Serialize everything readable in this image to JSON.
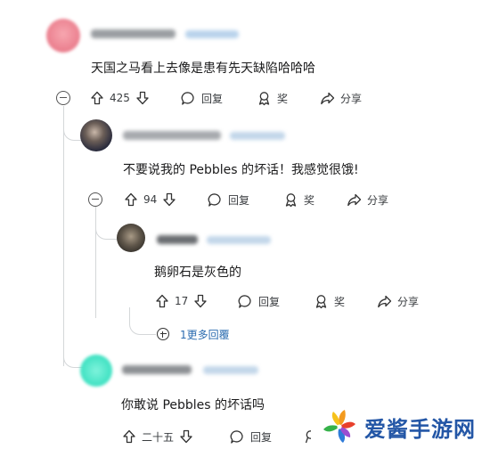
{
  "comments": [
    {
      "text": "天国之马看上去像是患有先天缺陷哈哈哈",
      "votes": "425",
      "reply_label": "回复",
      "award_label": "奖",
      "share_label": "分享"
    },
    {
      "text": "不要说我的 Pebbles 的坏话！我感觉很饿!",
      "votes": "94",
      "reply_label": "回复",
      "award_label": "奖",
      "share_label": "分享"
    },
    {
      "text": "鹅卵石是灰色的",
      "votes": "17",
      "reply_label": "回复",
      "award_label": "奖",
      "share_label": "分享",
      "more_replies": "1更多回覆"
    },
    {
      "text": "你敢说 Pebbles 的坏话吗",
      "votes": "二十五",
      "reply_label": "回复"
    }
  ],
  "watermark": {
    "text": "爱酱手游网"
  },
  "colors": {
    "avatar1": "#f08a98",
    "avatar2": "#3b3f55",
    "avatar3": "#5a5246",
    "avatar4": "#3fe0c0",
    "link": "#2b6cb0",
    "watermark": "#2356a6"
  }
}
